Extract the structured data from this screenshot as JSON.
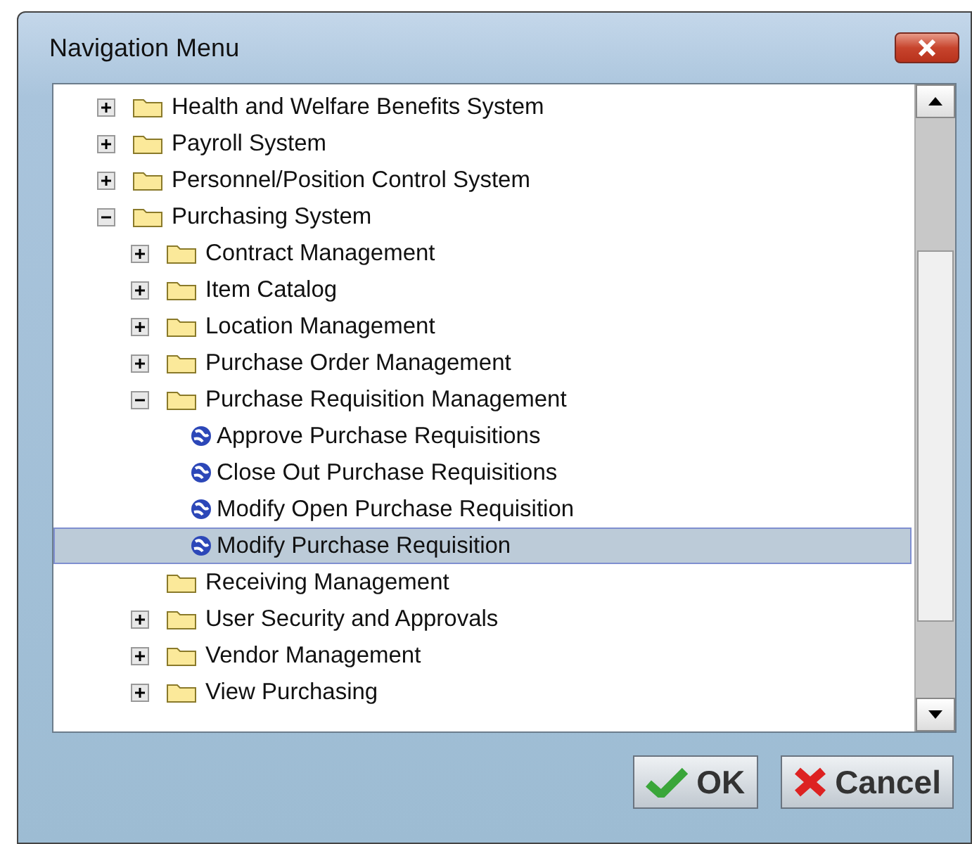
{
  "window": {
    "title": "Navigation Menu"
  },
  "tree": [
    {
      "kind": "folder",
      "label": "Health and Welfare Benefits System",
      "expanded": false
    },
    {
      "kind": "folder",
      "label": "Payroll System",
      "expanded": false
    },
    {
      "kind": "folder",
      "label": "Personnel/Position Control System",
      "expanded": false
    },
    {
      "kind": "folder",
      "label": "Purchasing System",
      "expanded": true,
      "children": [
        {
          "kind": "folder",
          "label": "Contract Management",
          "expanded": false
        },
        {
          "kind": "folder",
          "label": "Item Catalog",
          "expanded": false
        },
        {
          "kind": "folder",
          "label": "Location Management",
          "expanded": false
        },
        {
          "kind": "folder",
          "label": "Purchase Order Management",
          "expanded": false
        },
        {
          "kind": "folder",
          "label": "Purchase Requisition Management",
          "expanded": true,
          "children": [
            {
              "kind": "task",
              "label": "Approve Purchase Requisitions",
              "selected": false
            },
            {
              "kind": "task",
              "label": "Close Out Purchase Requisitions",
              "selected": false
            },
            {
              "kind": "task",
              "label": "Modify Open Purchase Requisition",
              "selected": false
            },
            {
              "kind": "task",
              "label": "Modify Purchase Requisition",
              "selected": true
            }
          ]
        },
        {
          "kind": "empty_folder",
          "label": "Receiving Management"
        },
        {
          "kind": "folder",
          "label": "User Security and Approvals",
          "expanded": false
        },
        {
          "kind": "folder",
          "label": "Vendor Management",
          "expanded": false
        },
        {
          "kind": "folder",
          "label": "View Purchasing",
          "expanded": false
        }
      ]
    }
  ],
  "buttons": [
    {
      "kind": "ok",
      "label": "OK"
    },
    {
      "kind": "cancel",
      "label": "Cancel"
    }
  ]
}
